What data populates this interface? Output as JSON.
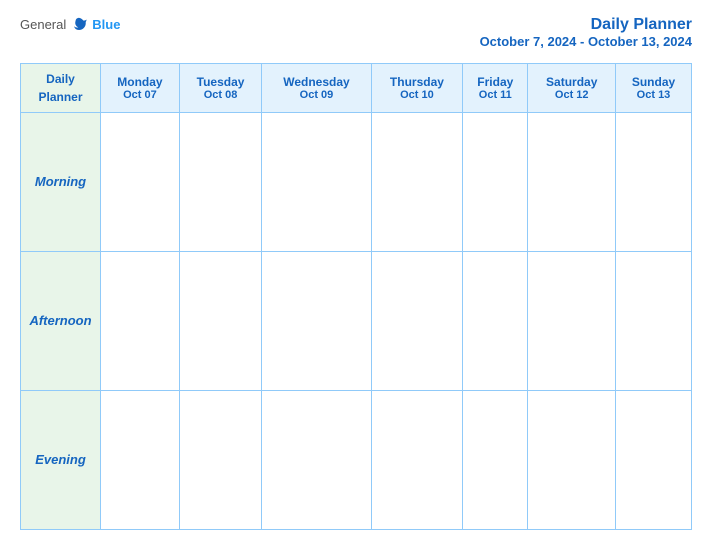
{
  "header": {
    "logo": {
      "general": "General",
      "blue": "Blue"
    },
    "title": "Daily Planner",
    "date_range": "October 7, 2024 - October 13, 2024"
  },
  "table": {
    "label_header": "Daily\nPlanner",
    "days": [
      {
        "name": "Monday",
        "date": "Oct 07"
      },
      {
        "name": "Tuesday",
        "date": "Oct 08"
      },
      {
        "name": "Wednesday",
        "date": "Oct 09"
      },
      {
        "name": "Thursday",
        "date": "Oct 10"
      },
      {
        "name": "Friday",
        "date": "Oct 11"
      },
      {
        "name": "Saturday",
        "date": "Oct 12"
      },
      {
        "name": "Sunday",
        "date": "Oct 13"
      }
    ],
    "time_slots": [
      {
        "label": "Morning"
      },
      {
        "label": "Afternoon"
      },
      {
        "label": "Evening"
      }
    ]
  }
}
